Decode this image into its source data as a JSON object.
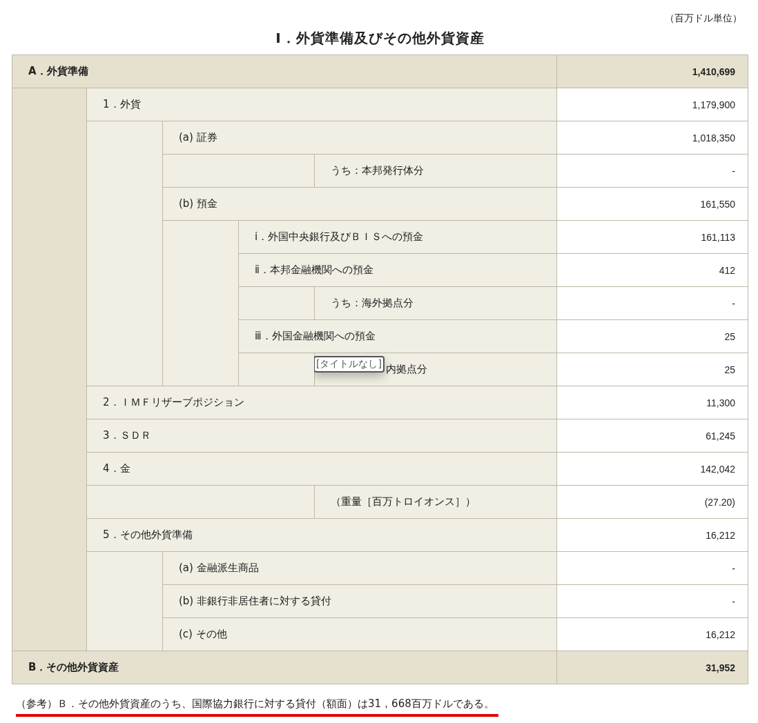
{
  "unit": "（百万ドル単位）",
  "title": "Ⅰ．外貨準備及びその他外貨資産",
  "table": {
    "rows": [
      {
        "label": "A．外貨準備",
        "value": "1,410,699",
        "children": [
          {
            "label": "1．外貨",
            "value": "1,179,900",
            "children": [
              {
                "label": "(a) 証券",
                "value": "1,018,350",
                "children": [
                  {
                    "kind": "note",
                    "label": "うち：本邦発行体分",
                    "value": "-"
                  }
                ]
              },
              {
                "label": "(b) 預金",
                "value": "161,550",
                "children": [
                  {
                    "label": "ⅰ．外国中央銀行及びＢＩＳへの預金",
                    "value": "161,113"
                  },
                  {
                    "label": "ⅱ．本邦金融機関への預金",
                    "value": "412",
                    "children": [
                      {
                        "label": "うち：海外拠点分",
                        "value": "-"
                      }
                    ]
                  },
                  {
                    "label": "ⅲ．外国金融機関への預金",
                    "value": "25",
                    "children": [
                      {
                        "label": "内拠点分",
                        "value": "25",
                        "tooltip": "[タイトルなし]"
                      }
                    ]
                  }
                ]
              }
            ]
          },
          {
            "label": "2．ＩＭＦリザーブポジション",
            "value": "11,300"
          },
          {
            "label": "3．ＳＤＲ",
            "value": "61,245"
          },
          {
            "label": "4．金",
            "value": "142,042",
            "children": [
              {
                "kind": "note",
                "label": "（重量［百万トロイオンス］）",
                "value": "(27.20)"
              }
            ]
          },
          {
            "label": "5．その他外貨準備",
            "value": "16,212",
            "children": [
              {
                "label": "(a) 金融派生商品",
                "value": "-"
              },
              {
                "label": "(b) 非銀行非居住者に対する貸付",
                "value": "-"
              },
              {
                "label": "(c) その他",
                "value": "16,212"
              }
            ]
          }
        ]
      },
      {
        "label": "B．その他外貨資産",
        "value": "31,952"
      }
    ]
  },
  "footnote": "（参考）Ｂ．その他外貨資産のうち、国際協力銀行に対する貸付（額面）は31，668百万ドルである。"
}
